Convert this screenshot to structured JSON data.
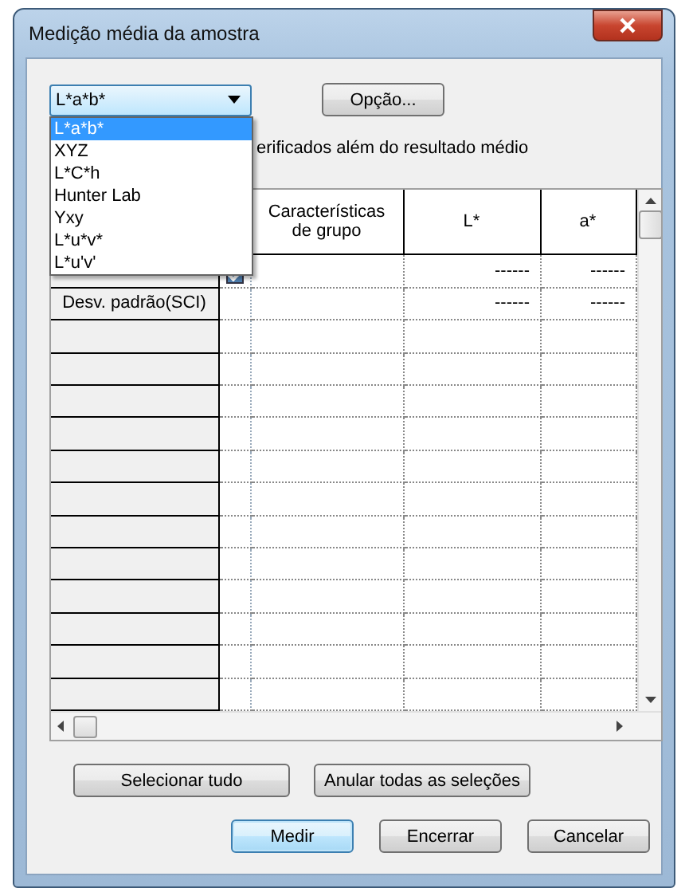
{
  "window": {
    "title": "Medição média da amostra"
  },
  "color_space": {
    "value": "L*a*b*",
    "options": [
      {
        "label": "L*a*b*",
        "selected": true
      },
      {
        "label": "XYZ",
        "selected": false
      },
      {
        "label": "L*C*h",
        "selected": false
      },
      {
        "label": "Hunter Lab",
        "selected": false
      },
      {
        "label": "Yxy",
        "selected": false
      },
      {
        "label": "L*u*v*",
        "selected": false
      },
      {
        "label": "L*u'v'",
        "selected": false
      }
    ]
  },
  "option_button": "Opção...",
  "checkbox_label": "erificados além do resultado médio",
  "table": {
    "columns": [
      "Características de grupo",
      "L*",
      "a*"
    ],
    "rows": [
      {
        "kind": "checkbox",
        "checked": true,
        "cells": [
          "",
          "------",
          "------"
        ]
      },
      {
        "kind": "plain",
        "header": "Desv. padrão(SCI)",
        "cells": [
          "",
          "------",
          "------"
        ]
      }
    ]
  },
  "selection_buttons": [
    "Selecionar tudo",
    "Anular todas as seleções"
  ],
  "dialog_buttons": [
    {
      "label": "Medir",
      "default": true
    },
    {
      "label": "Encerrar",
      "default": false
    },
    {
      "label": "Cancelar",
      "default": false
    }
  ]
}
